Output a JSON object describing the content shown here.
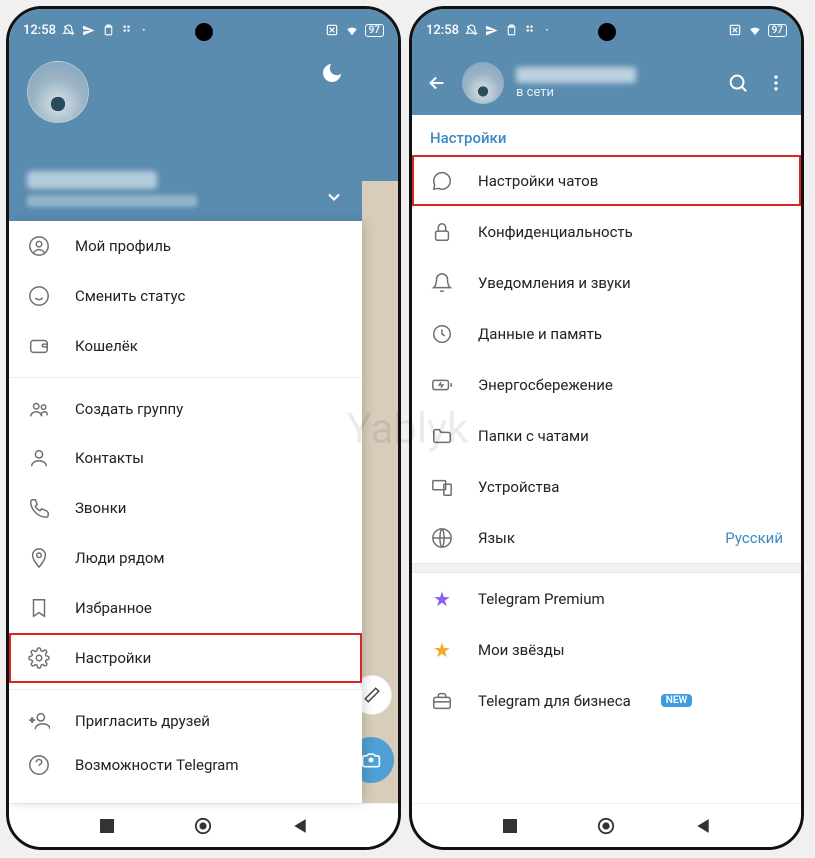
{
  "statusbar": {
    "time": "12:58",
    "battery": "97"
  },
  "leftPhone": {
    "menu": {
      "section1": [
        {
          "icon": "user-circle",
          "label": "Мой профиль"
        },
        {
          "icon": "smile",
          "label": "Сменить статус"
        },
        {
          "icon": "wallet",
          "label": "Кошелёк"
        }
      ],
      "section2": [
        {
          "icon": "group",
          "label": "Создать группу"
        },
        {
          "icon": "contact",
          "label": "Контакты"
        },
        {
          "icon": "phone",
          "label": "Звонки"
        },
        {
          "icon": "nearby",
          "label": "Люди рядом"
        },
        {
          "icon": "bookmark",
          "label": "Избранное"
        },
        {
          "icon": "gear",
          "label": "Настройки"
        }
      ],
      "section3": [
        {
          "icon": "invite",
          "label": "Пригласить друзей"
        },
        {
          "icon": "help",
          "label": "Возможности Telegram"
        }
      ]
    },
    "highlightedIndex": "Настройки"
  },
  "rightPhone": {
    "header": {
      "status": "в сети"
    },
    "sectionTitle": "Настройки",
    "items": [
      {
        "icon": "chat",
        "label": "Настройки чатов"
      },
      {
        "icon": "lock",
        "label": "Конфиденциальность"
      },
      {
        "icon": "bell",
        "label": "Уведомления и звуки"
      },
      {
        "icon": "data",
        "label": "Данные и память"
      },
      {
        "icon": "battery",
        "label": "Энергосбережение"
      },
      {
        "icon": "folder",
        "label": "Папки с чатами"
      },
      {
        "icon": "devices",
        "label": "Устройства"
      },
      {
        "icon": "globe",
        "label": "Язык",
        "value": "Русский"
      }
    ],
    "premiumItems": [
      {
        "icon": "star-purple",
        "label": "Telegram Premium"
      },
      {
        "icon": "star-gold",
        "label": "Мои звёзды"
      },
      {
        "icon": "briefcase",
        "label": "Telegram для бизнеса",
        "badge": "NEW"
      }
    ],
    "highlightedIndex": "Настройки чатов"
  },
  "watermark": "Yablyk"
}
